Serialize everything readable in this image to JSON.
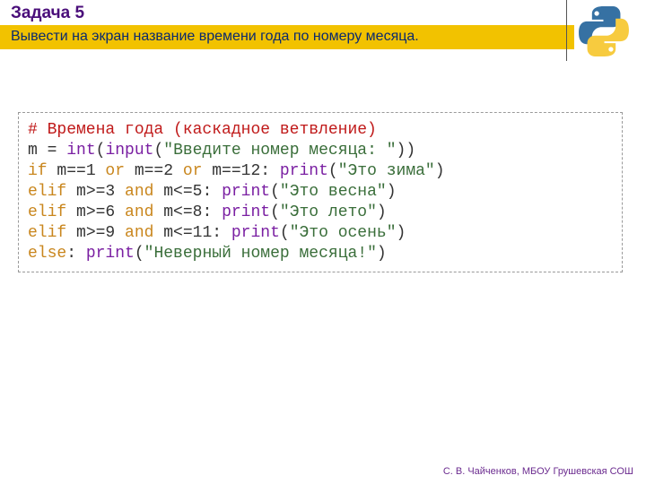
{
  "header": {
    "title": "Задача 5",
    "task": "Вывести на экран название времени года по номеру месяца."
  },
  "logo": {
    "name": "python-logo-icon"
  },
  "code": {
    "l1": "# Времена года (каскадное ветвление)",
    "l2a": "m = ",
    "l2b": "int",
    "l2c": "(",
    "l2d": "input",
    "l2e": "(",
    "l2f": "\"Введите номер месяца: \"",
    "l2g": "))",
    "l3a": "if",
    "l3b": " m==1 ",
    "l3c": "or",
    "l3d": " m==2 ",
    "l3e": "or",
    "l3f": " m==12: ",
    "l3g": "print",
    "l3h": "(",
    "l3i": "\"Это зима\"",
    "l3j": ")",
    "l4a": "elif",
    "l4b": " m>=3 ",
    "l4c": "and",
    "l4d": " m<=5: ",
    "l4e": "print",
    "l4f": "(",
    "l4g": "\"Это весна\"",
    "l4h": ")",
    "l5a": "elif",
    "l5b": " m>=6 ",
    "l5c": "and",
    "l5d": " m<=8: ",
    "l5e": "print",
    "l5f": "(",
    "l5g": "\"Это лето\"",
    "l5h": ")",
    "l6a": "elif",
    "l6b": " m>=9 ",
    "l6c": "and",
    "l6d": " m<=11: ",
    "l6e": "print",
    "l6f": "(",
    "l6g": "\"Это осень\"",
    "l6h": ")",
    "l7a": "else",
    "l7b": ": ",
    "l7c": "print",
    "l7d": "(",
    "l7e": "\"Неверный номер месяца!\"",
    "l7f": ")"
  },
  "footer": {
    "text": "С. В. Чайченков, МБОУ Грушевская СОШ"
  }
}
